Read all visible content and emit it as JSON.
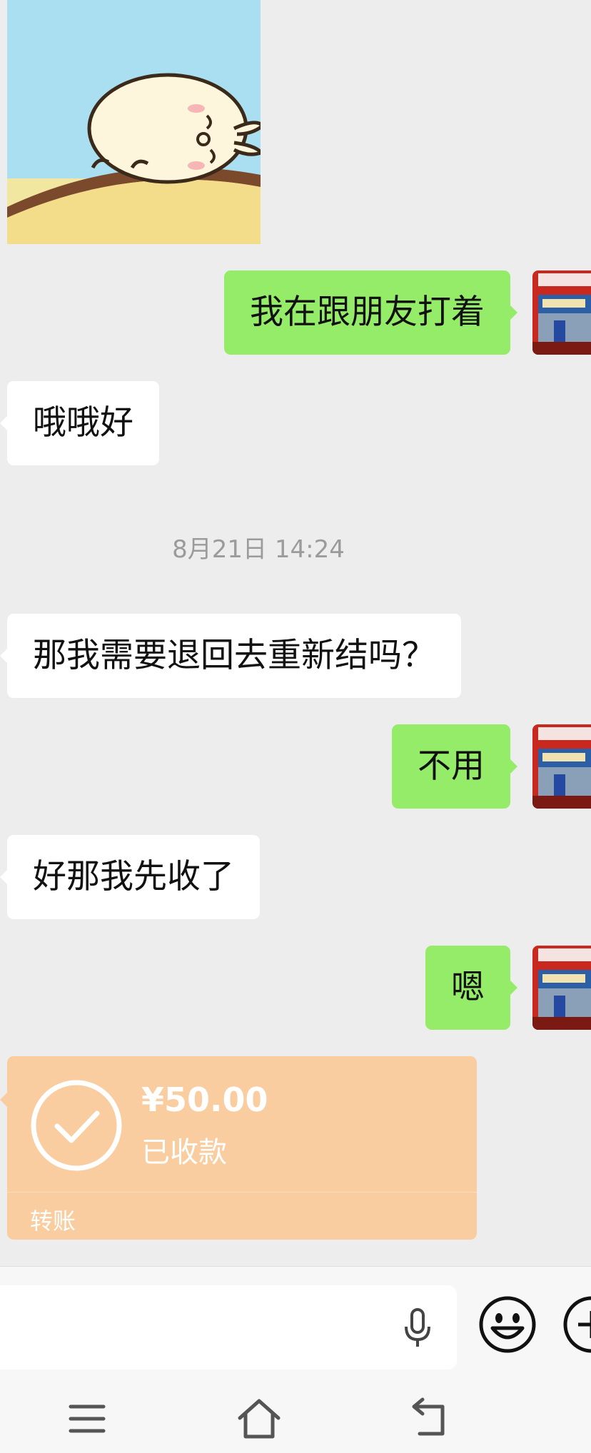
{
  "messages": [
    {
      "side": "right",
      "text": "我在跟朋友打着"
    },
    {
      "side": "left",
      "text": "哦哦好"
    },
    {
      "side": "left",
      "text": "那我需要退回去重新结吗？"
    },
    {
      "side": "right",
      "text": "不用"
    },
    {
      "side": "left",
      "text": "好那我先收了"
    },
    {
      "side": "right",
      "text": "嗯"
    }
  ],
  "timestamp": "8月21日 14:24",
  "transfer": {
    "amount": "¥50.00",
    "status": "已收款",
    "kind": "转账"
  },
  "input": {
    "value": ""
  },
  "icons": {
    "mic": "microphone-icon",
    "emoji": "emoji-icon",
    "plus": "plus-icon",
    "check": "check-circle-icon",
    "menu": "menu-icon",
    "home": "home-icon",
    "back": "back-icon"
  },
  "colors": {
    "background": "#ededed",
    "bubble_self": "#95ec69",
    "bubble_other": "#ffffff",
    "transfer_received": "#f9cda0",
    "timestamp_text": "#9b9b9b"
  }
}
